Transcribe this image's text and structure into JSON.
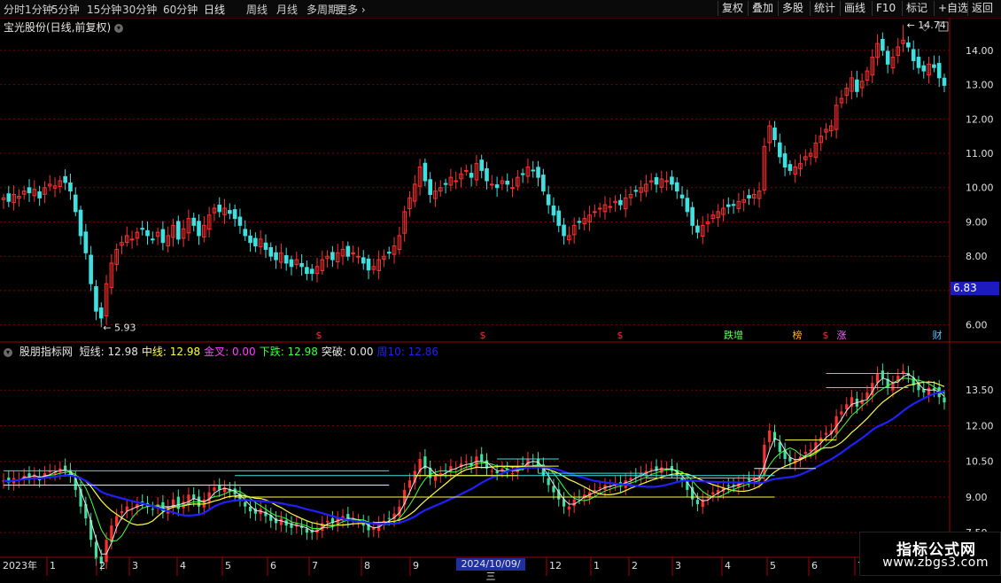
{
  "toolbar": {
    "periods": [
      "分时",
      "1分钟",
      "5分钟",
      "15分钟",
      "30分钟",
      "60分钟",
      "日线",
      "周线",
      "月线",
      "多周期",
      "更多"
    ],
    "active_period": "日线",
    "right_buttons": [
      "复权",
      "叠加",
      "多股",
      "统计",
      "画线",
      "F10",
      "标记",
      "+自选",
      "返回"
    ]
  },
  "main_chart": {
    "title": "宝光股份(日线,前复权)",
    "high_label": "14.74",
    "low_label": "5.93",
    "current_price_box": "6.83",
    "event_markers": [
      "$",
      "$",
      "$",
      "跌增",
      "榜",
      "$",
      "涨",
      "财"
    ]
  },
  "indicator": {
    "name": "股朋指标网",
    "items": [
      {
        "label": "短线:",
        "value": "12.98",
        "color": "#e6e6e6"
      },
      {
        "label": "中线:",
        "value": "12.98",
        "color": "#ffff40"
      },
      {
        "label": "金叉:",
        "value": "0.00",
        "color": "#ff40ff"
      },
      {
        "label": "下跌:",
        "value": "12.98",
        "color": "#40ff40"
      },
      {
        "label": "突破:",
        "value": "0.00",
        "color": "#e6e6e6"
      },
      {
        "label": "周10:",
        "value": "12.86",
        "color": "#2020ff"
      }
    ]
  },
  "date_axis": {
    "year_label": "2023年",
    "months": [
      "1",
      "2",
      "3",
      "4",
      "5",
      "6",
      "7",
      "8",
      "9",
      "12",
      "1",
      "2",
      "3",
      "4",
      "5",
      "6",
      "7"
    ],
    "selected_date": "2024/10/09/三"
  },
  "watermark": {
    "title": "指标公式网",
    "url": "www.zbgs3.com"
  },
  "colors": {
    "up": "#ff3030",
    "down": "#40e0e0",
    "grid": "#7a0000",
    "axis_text": "#e0e0e0"
  },
  "chart_data": [
    {
      "type": "candlestick",
      "title": "宝光股份(日线,前复权)",
      "y_ticks": [
        "14.00",
        "13.00",
        "12.00",
        "11.00",
        "10.00",
        "9.00",
        "8.00",
        "7.00",
        "6.00"
      ],
      "ylim": [
        5.5,
        14.9
      ],
      "closes": [
        9.7,
        9.6,
        9.8,
        9.75,
        9.9,
        9.85,
        9.95,
        9.7,
        10.0,
        10.1,
        10.05,
        10.2,
        10.15,
        9.9,
        9.3,
        8.6,
        8.1,
        7.2,
        6.4,
        6.2,
        7.2,
        7.8,
        8.2,
        8.4,
        8.6,
        8.5,
        8.7,
        8.8,
        8.6,
        8.5,
        8.7,
        8.4,
        8.6,
        8.9,
        8.5,
        8.8,
        9.1,
        8.9,
        8.6,
        8.9,
        9.2,
        9.4,
        9.3,
        9.4,
        9.25,
        9.1,
        8.9,
        8.6,
        8.4,
        8.3,
        8.5,
        8.2,
        8.0,
        7.9,
        8.1,
        7.8,
        7.7,
        7.9,
        7.7,
        7.5,
        7.5,
        7.7,
        7.9,
        8.0,
        7.9,
        8.1,
        8.2,
        8.0,
        8.1,
        8.0,
        7.8,
        7.6,
        7.7,
        7.9,
        8.0,
        8.1,
        8.3,
        8.6,
        9.3,
        9.7,
        10.1,
        10.6,
        10.2,
        9.8,
        9.9,
        10.0,
        10.1,
        10.3,
        10.2,
        10.4,
        10.5,
        10.3,
        10.7,
        10.5,
        10.2,
        10.1,
        10.0,
        10.2,
        10.1,
        10.0,
        10.3,
        10.4,
        10.6,
        10.5,
        10.3,
        9.9,
        9.5,
        9.2,
        8.9,
        8.6,
        8.6,
        8.9,
        9.0,
        9.1,
        9.2,
        9.3,
        9.4,
        9.5,
        9.45,
        9.6,
        9.5,
        9.7,
        9.8,
        9.9,
        10.0,
        10.1,
        10.2,
        10.1,
        10.25,
        10.2,
        10.1,
        9.9,
        9.7,
        9.3,
        8.9,
        8.7,
        8.9,
        9.0,
        9.2,
        9.3,
        9.4,
        9.45,
        9.5,
        9.6,
        9.65,
        9.7,
        9.8,
        9.9,
        11.2,
        11.8,
        11.4,
        10.9,
        10.6,
        10.5,
        10.6,
        10.7,
        10.9,
        11.0,
        11.3,
        11.5,
        11.7,
        11.8,
        12.4,
        12.6,
        12.9,
        13.2,
        12.8,
        13.1,
        13.4,
        13.8,
        14.2,
        14.0,
        13.6,
        13.8,
        14.1,
        14.3,
        14.1,
        13.7,
        13.5,
        13.4,
        13.6,
        13.5,
        13.2,
        12.98
      ],
      "high_value": 14.74,
      "low_value": 5.93
    },
    {
      "type": "line",
      "title": "股朋指标网",
      "y_ticks": [
        "13.50",
        "12.00",
        "10.50",
        "9.00",
        "7.50"
      ],
      "ylim": [
        6.5,
        15.0
      ],
      "series": [
        {
          "name": "短线",
          "color": "#e6e6e6"
        },
        {
          "name": "中线",
          "color": "#ffff40"
        },
        {
          "name": "下跌",
          "color": "#40ff40"
        },
        {
          "name": "周10",
          "color": "#2020ff"
        }
      ]
    }
  ]
}
